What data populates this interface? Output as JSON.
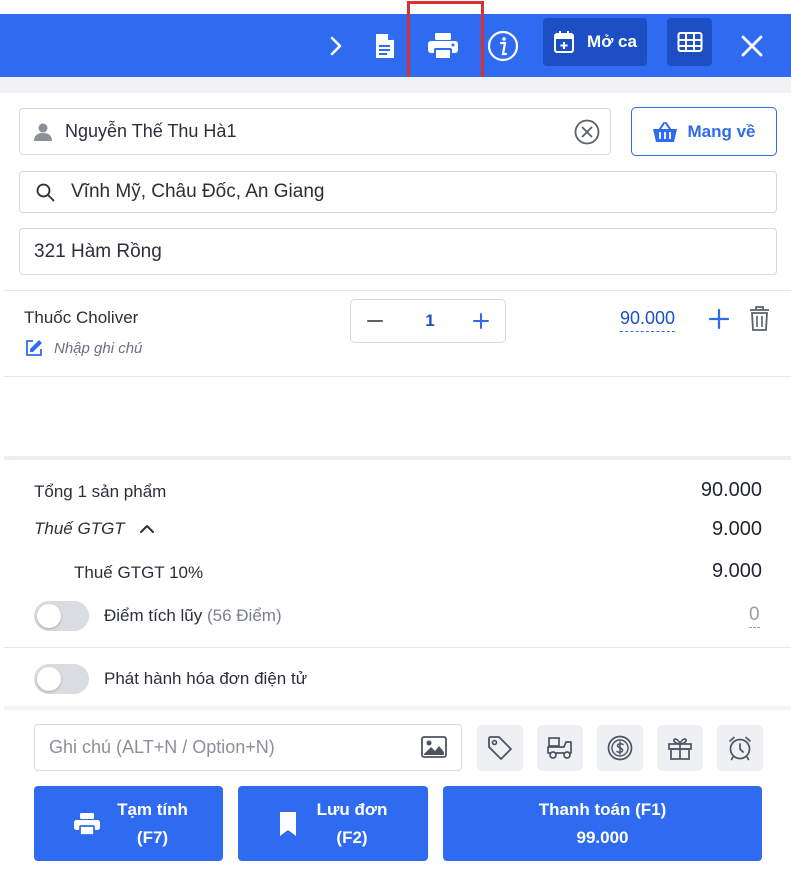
{
  "toolbar": {
    "shift_button_label": "Mở ca",
    "icons": [
      "chevron-right-icon",
      "document-icon",
      "printer-icon",
      "info-icon",
      "calendar-plus-icon",
      "table-grid-icon",
      "close-icon"
    ]
  },
  "customer": {
    "name": "Nguyễn Thế Thu Hà1",
    "takeaway_label": "Mang về",
    "location": "Vĩnh Mỹ, Châu Đốc, An Giang",
    "address": "321 Hàm Rồng"
  },
  "items": [
    {
      "name": "Thuốc Choliver",
      "note_placeholder": "Nhập ghi chú",
      "quantity": "1",
      "price": "90.000"
    }
  ],
  "summary": {
    "total_label": "Tổng 1 sản phẩm",
    "total_value": "90.000",
    "vat_label": "Thuế GTGT",
    "vat_value": "9.000",
    "vat_rate_label": "Thuế GTGT 10%",
    "vat_rate_value": "9.000",
    "points_label": "Điểm tích lũy",
    "points_count": "(56 Điểm)",
    "points_value": "0",
    "einvoice_label": "Phát hành hóa đơn điện tử"
  },
  "note": {
    "placeholder": "Ghi chú (ALT+N / Option+N)"
  },
  "actions": {
    "temp_label": "Tạm tính",
    "temp_key": "(F7)",
    "save_label": "Lưu đơn",
    "save_key": "(F2)",
    "pay_label": "Thanh toán (F1)",
    "pay_amount": "99.000"
  },
  "colors": {
    "primary": "#2f6bf0",
    "primary_dark": "#1d4fc4",
    "highlight": "#d93030"
  }
}
